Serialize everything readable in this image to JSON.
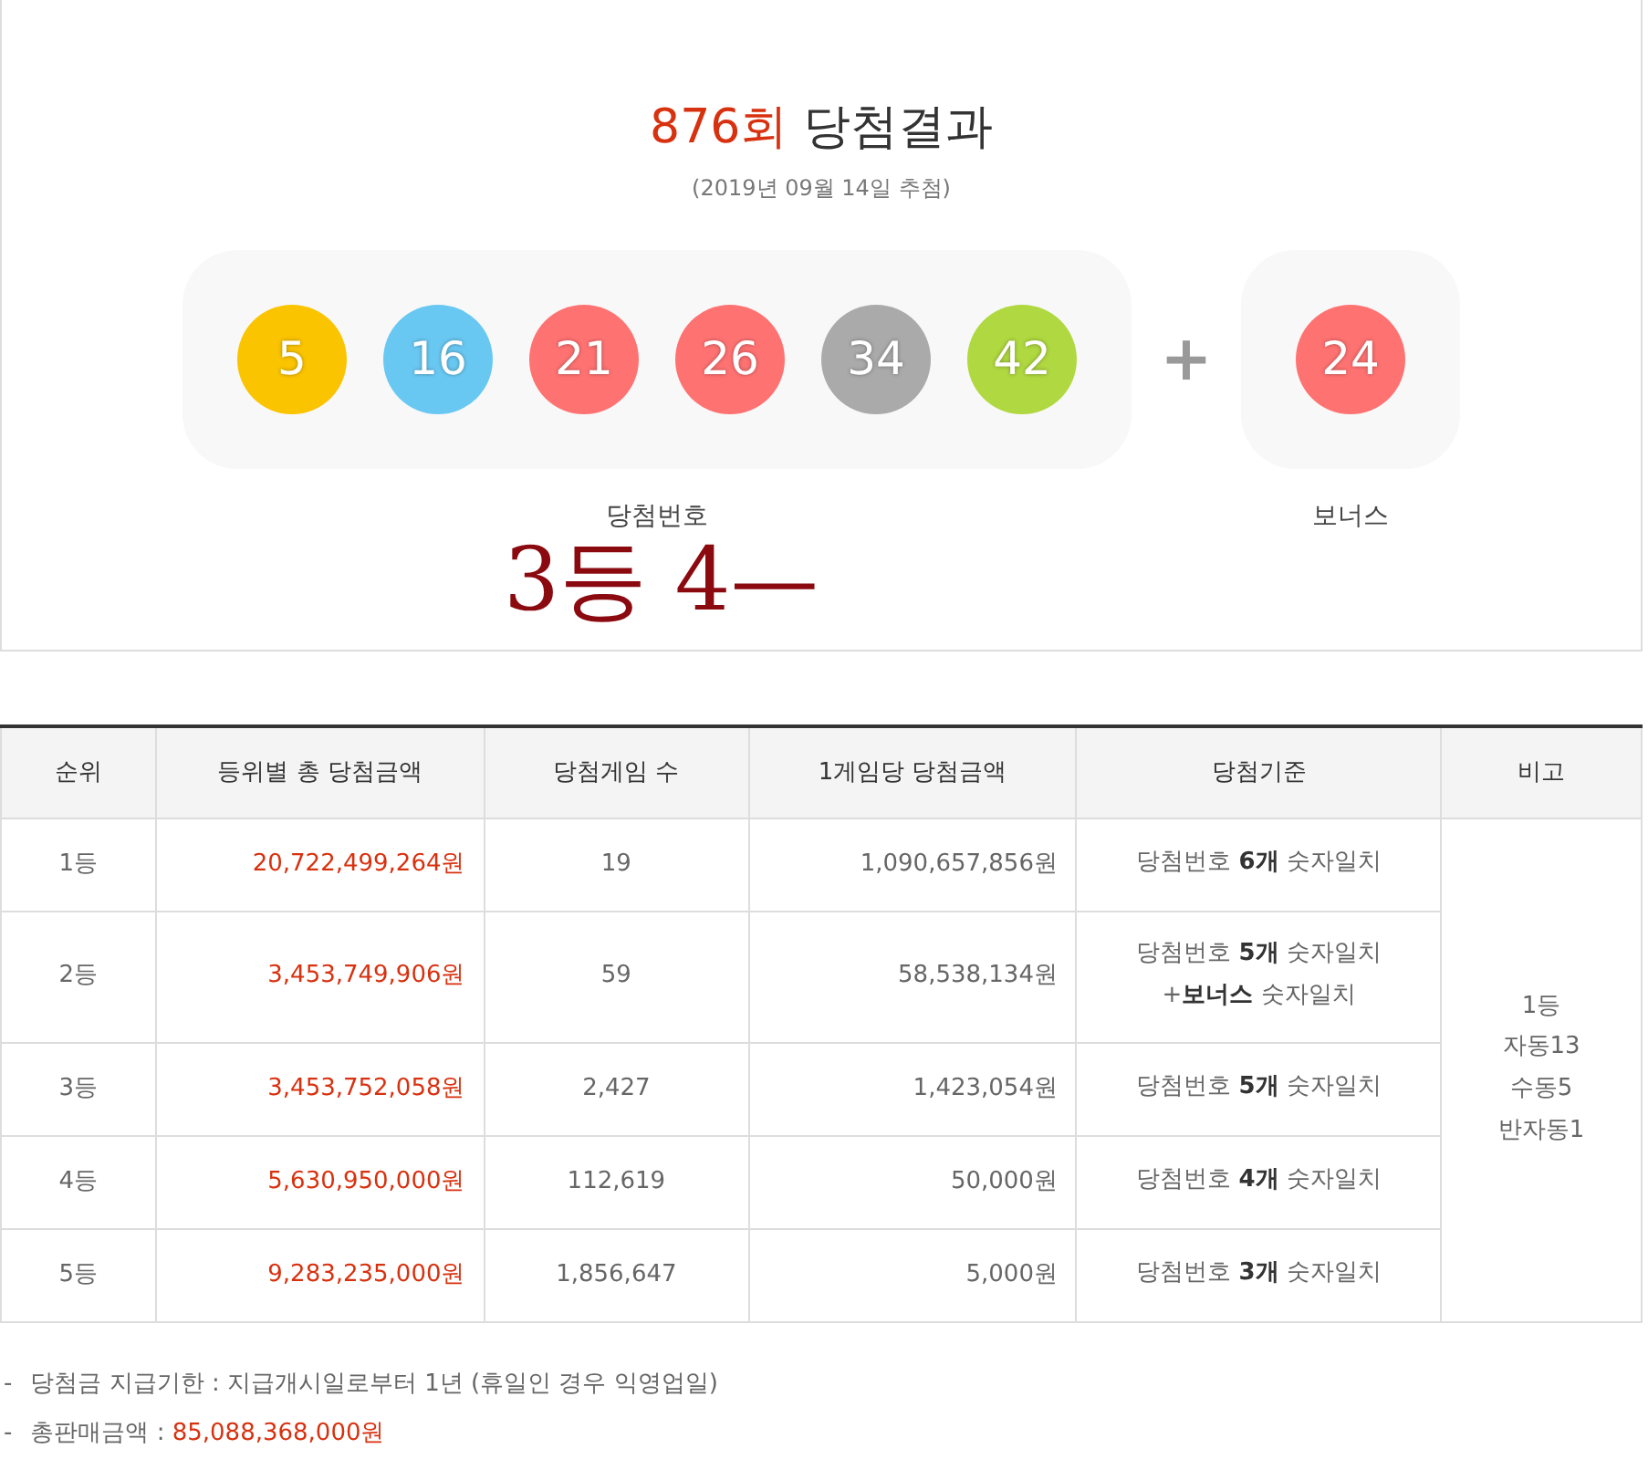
{
  "result": {
    "round": "876회",
    "title": "당첨결과",
    "date": "(2019년 09월 14일 추첨)",
    "numbers": [
      {
        "value": "5",
        "color": "#fbc400"
      },
      {
        "value": "16",
        "color": "#69c8f2"
      },
      {
        "value": "21",
        "color": "#ff7272"
      },
      {
        "value": "26",
        "color": "#ff7272"
      },
      {
        "value": "34",
        "color": "#aaaaaa"
      },
      {
        "value": "42",
        "color": "#b0d840"
      }
    ],
    "plus": "+",
    "bonus": {
      "value": "24",
      "color": "#ff7272"
    },
    "numbers_label": "당첨번호",
    "bonus_label": "보너스",
    "handwritten_note": "3등 4—"
  },
  "table": {
    "columns": [
      "순위",
      "등위별 총 당첨금액",
      "당첨게임 수",
      "1게임당 당첨금액",
      "당첨기준",
      "비고"
    ],
    "rows": [
      {
        "rank": "1등",
        "total": "20,722,499,264원",
        "games": "19",
        "per_game": "1,090,657,856원",
        "criteria": "당첨번호 **6개** 숫자일치"
      },
      {
        "rank": "2등",
        "total": "3,453,749,906원",
        "games": "59",
        "per_game": "58,538,134원",
        "criteria": "당첨번호 **5개** 숫자일치\n+**보너스** 숫자일치"
      },
      {
        "rank": "3등",
        "total": "3,453,752,058원",
        "games": "2,427",
        "per_game": "1,423,054원",
        "criteria": "당첨번호 **5개** 숫자일치"
      },
      {
        "rank": "4등",
        "total": "5,630,950,000원",
        "games": "112,619",
        "per_game": "50,000원",
        "criteria": "당첨번호 **4개** 숫자일치"
      },
      {
        "rank": "5등",
        "total": "9,283,235,000원",
        "games": "1,856,647",
        "per_game": "5,000원",
        "criteria": "당첨번호 **3개** 숫자일치"
      }
    ],
    "remarks": "1등\n자동13\n수동5\n반자동1"
  },
  "notes": [
    {
      "bullet": "-",
      "label": "당첨금 지급기한 : 지급개시일로부터 1년 (휴일인 경우 익영업일)"
    },
    {
      "bullet": "-",
      "label": "총판매금액 : ",
      "value": "85,088,368,000원"
    }
  ]
}
